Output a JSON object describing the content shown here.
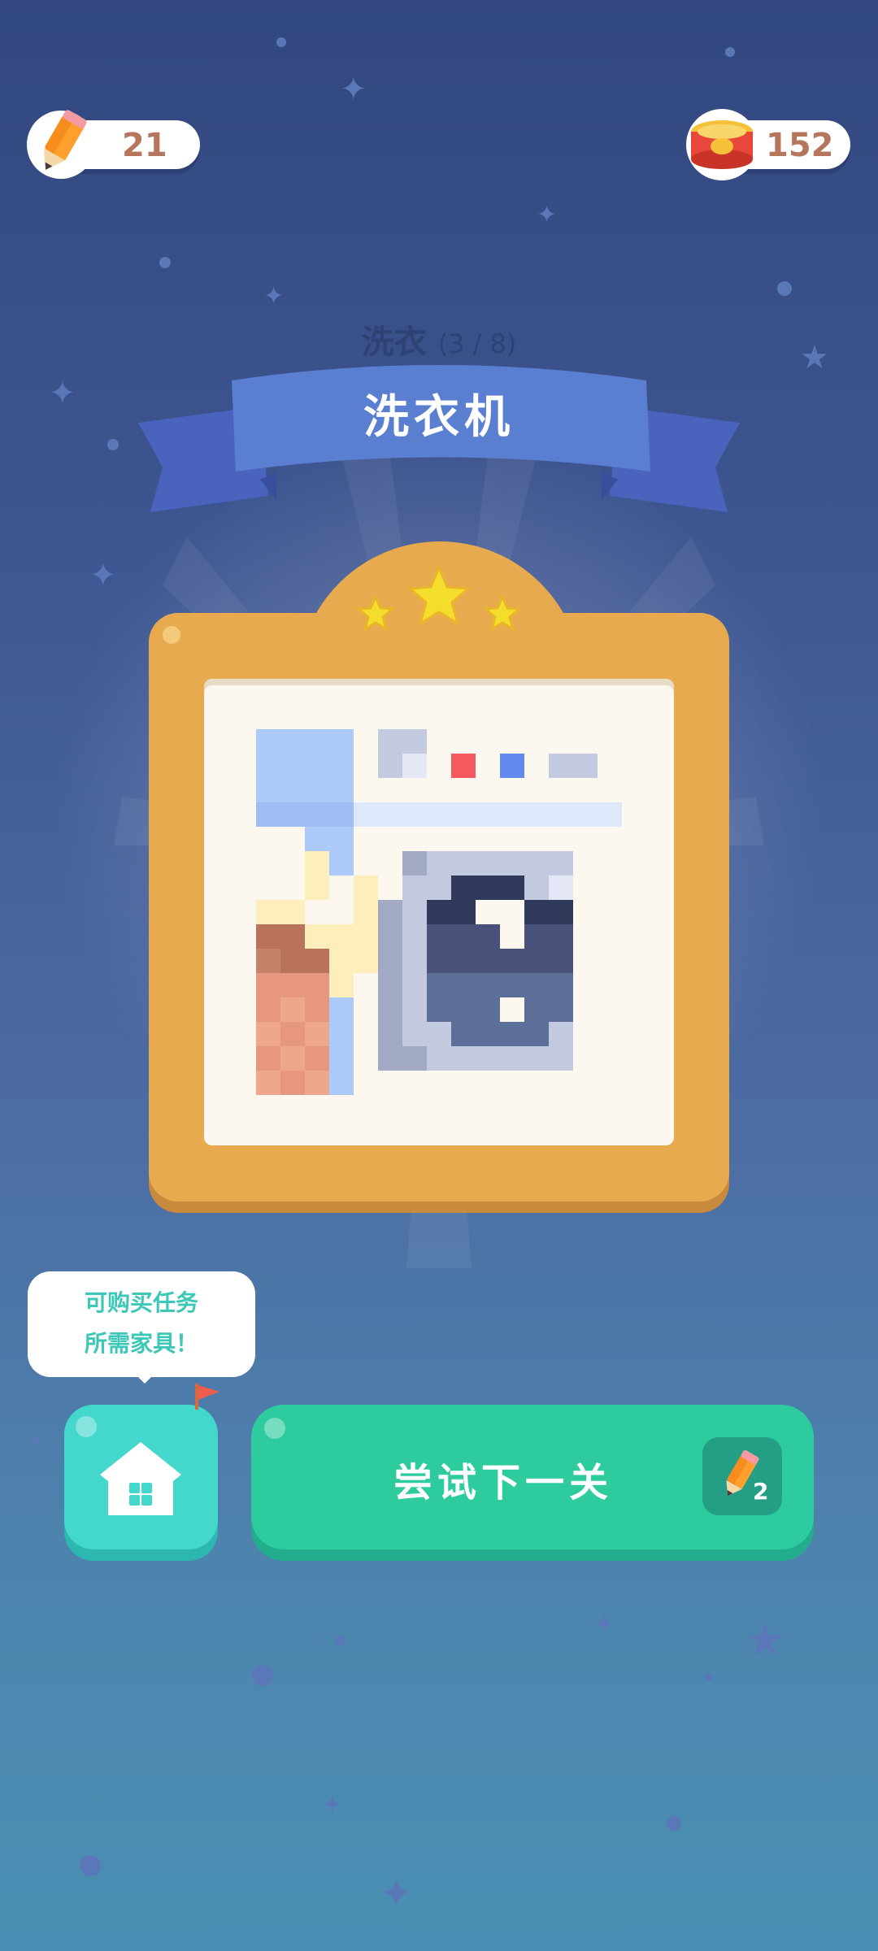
{
  "currency": {
    "pencils": "21",
    "coins": "152"
  },
  "level": {
    "category": "洗衣",
    "progress": "(3 / 8)",
    "title": "洗衣机",
    "stars_earned": 3,
    "stars_total": 3
  },
  "tooltip": {
    "line1": "可购买任务",
    "line2": "所需家具！"
  },
  "buttons": {
    "next_label": "尝试下一关",
    "next_cost": "2"
  },
  "icons": {
    "pencil": "pencil-icon",
    "coin": "coin-can-icon",
    "home": "home-icon",
    "flag": "flag-icon",
    "star": "star-icon"
  },
  "colors": {
    "accent_green": "#2ecb9f",
    "home_teal": "#44d8cc",
    "frame_orange": "#e8aa4f",
    "ribbon_blue": "#5a7fd0"
  }
}
